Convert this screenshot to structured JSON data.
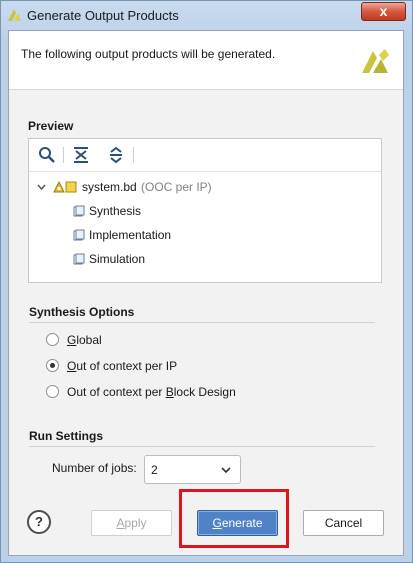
{
  "window": {
    "title": "Generate Output Products",
    "close_label": "x"
  },
  "header": {
    "text": "The following output products will be generated."
  },
  "preview": {
    "label": "Preview",
    "tree": {
      "root_name": "system.bd",
      "root_suffix": "(OOC per IP)",
      "children": [
        "Synthesis",
        "Implementation",
        "Simulation"
      ]
    }
  },
  "synthesis_options": {
    "label": "Synthesis Options",
    "options": [
      {
        "pre": "",
        "mnemonic": "G",
        "post": "lobal",
        "selected": false
      },
      {
        "pre": "",
        "mnemonic": "O",
        "post": "ut of context per IP",
        "selected": true
      },
      {
        "pre": "Out of context per ",
        "mnemonic": "B",
        "post": "lock Design",
        "selected": false
      }
    ]
  },
  "run_settings": {
    "label": "Run Settings",
    "jobs_label_pre": "Number of ",
    "jobs_label_mnemonic": "j",
    "jobs_label_post": "obs:",
    "jobs_value": "2"
  },
  "buttons": {
    "help": "?",
    "apply_pre": "",
    "apply_mnemonic": "A",
    "apply_post": "pply",
    "generate_pre": "",
    "generate_mnemonic": "G",
    "generate_post": "enerate",
    "cancel": "Cancel"
  },
  "colors": {
    "accent": "#4f82c7",
    "highlight": "#e0141c",
    "logo": "#c8c43c"
  }
}
